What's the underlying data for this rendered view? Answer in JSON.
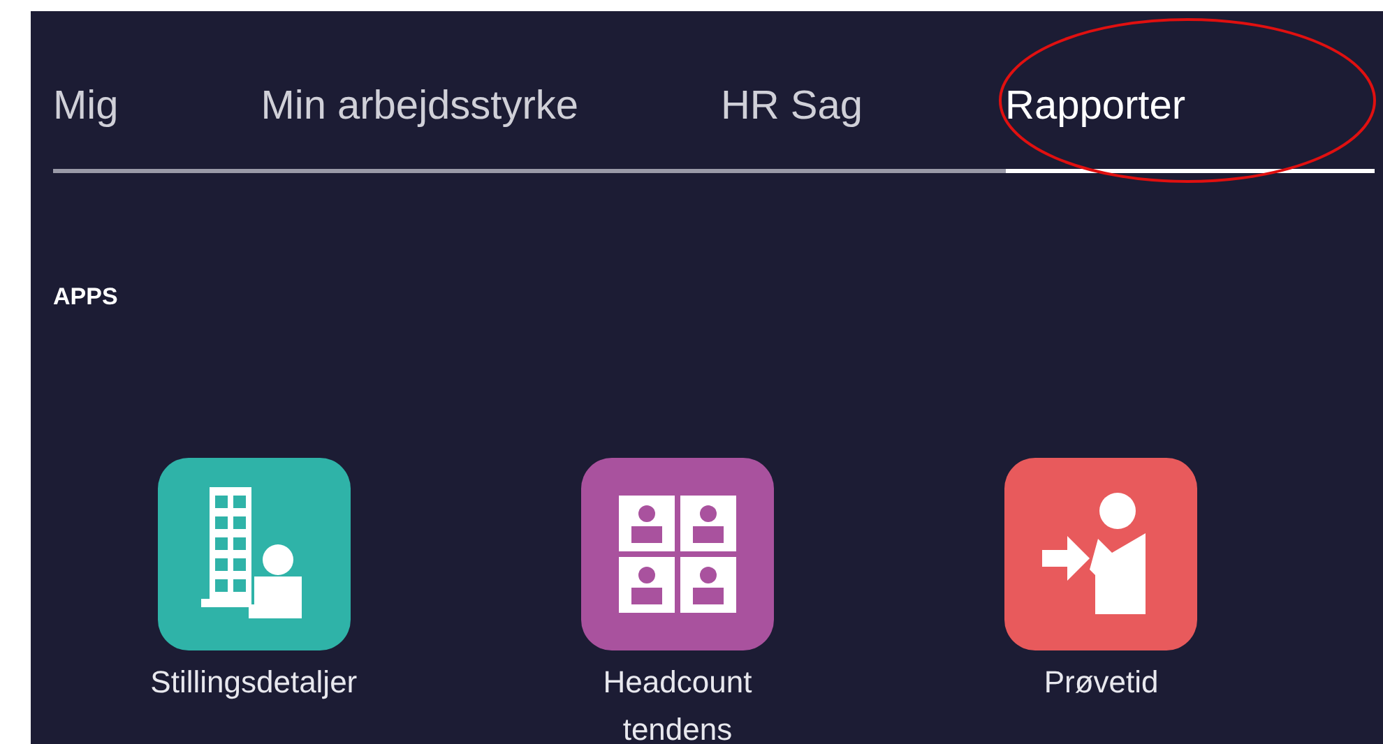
{
  "tabs": [
    {
      "label": "Mig",
      "selected": false
    },
    {
      "label": "Min arbejdsstyrke",
      "selected": false
    },
    {
      "label": "HR Sag",
      "selected": false
    },
    {
      "label": "Rapporter",
      "selected": true
    }
  ],
  "section_title": "APPS",
  "apps": [
    {
      "label": "Stillingsdetaljer",
      "kind": "building",
      "color": "#2fb3a8"
    },
    {
      "label": "Headcount tendens",
      "kind": "grid",
      "color": "#a9529e"
    },
    {
      "label": "Prøvetid",
      "kind": "arrow",
      "color": "#e85a5c"
    }
  ]
}
